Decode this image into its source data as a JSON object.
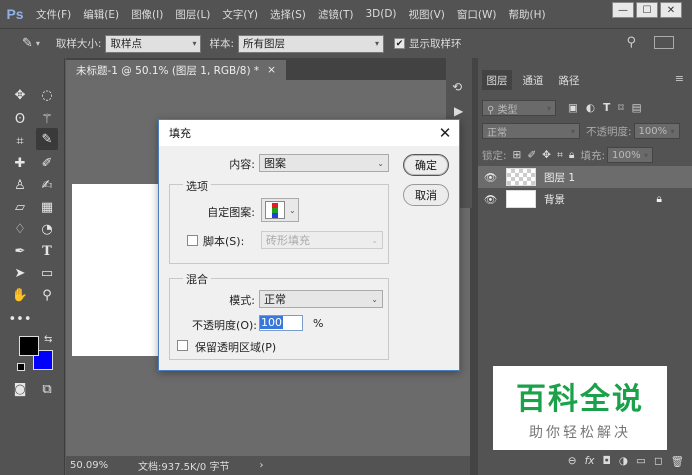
{
  "app": {
    "logo": "Ps",
    "menus": [
      "文件(F)",
      "编辑(E)",
      "图像(I)",
      "图层(L)",
      "文字(Y)",
      "选择(S)",
      "滤镜(T)",
      "3D(D)",
      "视图(V)",
      "窗口(W)",
      "帮助(H)"
    ],
    "window_controls": [
      "minimize-icon",
      "maximize-icon",
      "close-icon"
    ]
  },
  "options_bar": {
    "sample_size_label": "取样大小:",
    "sample_size_value": "取样点",
    "sample_label": "样本:",
    "sample_value": "所有图层",
    "show_ring_label": "显示取样环",
    "show_ring_checked": true
  },
  "document": {
    "tab_title": "未标题-1 @ 50.1% (图层 1, RGB/8) *",
    "tab_close": "×",
    "zoom": "50.09%",
    "doc_info": "文档:937.5K/0 字节"
  },
  "colors": {
    "foreground": "#000000",
    "background": "#0000ff",
    "accent": "#1aa14a"
  },
  "layers_panel": {
    "tabs": [
      "图层",
      "通道",
      "路径"
    ],
    "filter_label": "类型",
    "blend_mode": "正常",
    "opacity_label": "不透明度:",
    "opacity_value": "100%",
    "lock_label": "锁定:",
    "fill_label": "填充:",
    "fill_value": "100%",
    "layers": [
      {
        "name": "图层 1",
        "selected": true
      },
      {
        "name": "背景",
        "selected": false,
        "locked": true
      }
    ]
  },
  "dialog": {
    "title": "填充",
    "content_label": "内容:",
    "content_value": "图案",
    "ok_label": "确定",
    "cancel_label": "取消",
    "options_group": "选项",
    "custom_pattern_label": "自定图案:",
    "script_label": "脚本(S):",
    "script_value": "砖形填充",
    "blend_group": "混合",
    "mode_label": "模式:",
    "mode_value": "正常",
    "opacity_label": "不透明度(O):",
    "opacity_value": "100",
    "opacity_unit": "%",
    "preserve_label": "保留透明区域(P)"
  },
  "watermark": {
    "title": "百科全说",
    "subtitle": "助你轻松解决"
  }
}
